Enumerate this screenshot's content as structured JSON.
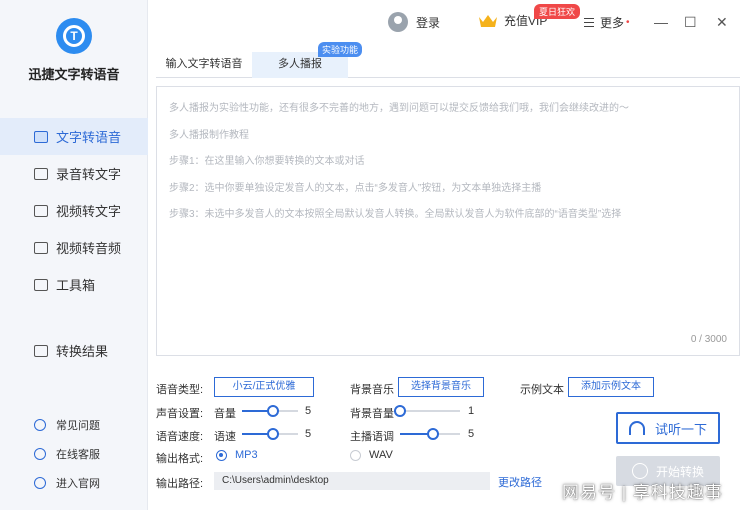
{
  "app": {
    "title": "迅捷文字转语音"
  },
  "sidebar": {
    "items": [
      {
        "label": "文字转语音",
        "active": true
      },
      {
        "label": "录音转文字"
      },
      {
        "label": "视频转文字"
      },
      {
        "label": "视频转音频"
      },
      {
        "label": "工具箱"
      }
    ],
    "results": "转换结果",
    "links": [
      {
        "label": "常见问题"
      },
      {
        "label": "在线客服"
      },
      {
        "label": "进入官网"
      }
    ]
  },
  "topbar": {
    "login": "登录",
    "vip": "充值VIP",
    "vip_badge": "夏日狂欢",
    "more": "更多",
    "more_dot": "•",
    "minimize": "—",
    "maximize": "☐",
    "close": "✕"
  },
  "tabs": [
    {
      "label": "输入文字转语音"
    },
    {
      "label": "多人播报",
      "active": true
    }
  ],
  "beta_badge": "实验功能",
  "editor": {
    "lines": [
      "多人播报为实验性功能，还有很多不完善的地方，遇到问题可以提交反馈给我们哦，我们会继续改进的～",
      "多人播报制作教程",
      "步骤1：在这里输入你想要转换的文本或对话",
      "步骤2：选中你要单独设定发音人的文本，点击“多发音人”按钮，为文本单独选择主播",
      "步骤3：未选中多发音人的文本按照全局默认发音人转换。全局默认发音人为软件底部的“语音类型”选择"
    ],
    "counter": "0 / 3000"
  },
  "settings": {
    "voice_type_label": "语音类型:",
    "voice_type_btn": "小云/正式优雅",
    "bg_music_label": "背景音乐",
    "bg_music_btn": "选择背景音乐",
    "example_label": "示例文本",
    "example_btn": "添加示例文本",
    "sound_label": "声音设置:",
    "volume_label": "音量",
    "volume_value": "5",
    "volume_level": 0.55,
    "bg_volume_label": "背景音量",
    "bg_volume_value": "1",
    "bg_volume_level": 0.0,
    "speed_label": "语音速度:",
    "speed_sub": "语速",
    "speed_value": "5",
    "speed_level": 0.55,
    "pitch_label": "主播语调",
    "pitch_value": "5",
    "pitch_level": 0.55,
    "format_label": "输出格式:",
    "format_mp3": "MP3",
    "format_wav": "WAV",
    "path_label": "输出路径:",
    "path_value": "C:\\Users\\admin\\desktop",
    "change_path": "更改路径"
  },
  "actions": {
    "listen": "试听一下",
    "start": "开始转换"
  },
  "watermark": "网易号 | 享科技趣事",
  "colors": {
    "accent": "#2d6ad6",
    "badge": "#f04848"
  }
}
